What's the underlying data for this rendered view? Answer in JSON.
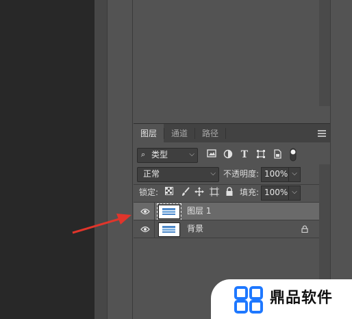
{
  "layers_panel": {
    "tabs": [
      {
        "label": "图层",
        "active": true
      },
      {
        "label": "通道",
        "active": false
      },
      {
        "label": "路径",
        "active": false
      }
    ],
    "filter": {
      "label": "类型"
    },
    "blend_mode": {
      "value": "正常"
    },
    "opacity": {
      "label": "不透明度:",
      "value": "100%"
    },
    "lock": {
      "label": "锁定:"
    },
    "fill": {
      "label": "填充:",
      "value": "100%"
    },
    "layers": [
      {
        "name": "图层 1",
        "selected": true,
        "locked": false
      },
      {
        "name": "背景",
        "selected": false,
        "locked": true
      }
    ]
  },
  "annotation": {
    "arrow_color": "#e0352b"
  },
  "watermark": {
    "text": "鼎品软件",
    "color": "#1e78ff"
  },
  "colors": {
    "panel_bg": "#535353",
    "selected_row": "#6a6a6a",
    "canvas_bg": "#282828"
  }
}
